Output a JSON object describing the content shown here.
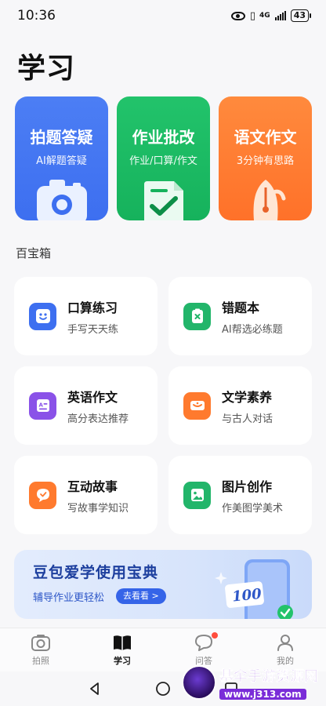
{
  "status": {
    "time": "10:36",
    "network": "4G",
    "battery": "43"
  },
  "page_title": "学习",
  "feature_cards": [
    {
      "title": "拍题答疑",
      "subtitle": "AI解题答疑",
      "icon": "camera-icon",
      "color": "#4c7ef4"
    },
    {
      "title": "作业批改",
      "subtitle": "作业/口算/作文",
      "icon": "check-document-icon",
      "color": "#22c36b"
    },
    {
      "title": "语文作文",
      "subtitle": "3分钟有思路",
      "icon": "pen-nib-icon",
      "color": "#ff8a3d"
    }
  ],
  "section_label": "百宝箱",
  "tools": [
    {
      "title": "口算练习",
      "subtitle": "手写天天练",
      "icon": "smile-face-icon",
      "color": "#3d6ff0"
    },
    {
      "title": "错题本",
      "subtitle": "AI帮选必练题",
      "icon": "wrong-clipboard-icon",
      "color": "#22b56a"
    },
    {
      "title": "英语作文",
      "subtitle": "高分表达推荐",
      "icon": "english-doc-icon",
      "color": "#8a52e8"
    },
    {
      "title": "文学素养",
      "subtitle": "与古人对话",
      "icon": "scroll-icon",
      "color": "#ff7a2e"
    },
    {
      "title": "互动故事",
      "subtitle": "写故事学知识",
      "icon": "chat-bubbles-icon",
      "color": "#ff7a2e"
    },
    {
      "title": "图片创作",
      "subtitle": "作美图学美术",
      "icon": "image-icon",
      "color": "#22b56a"
    }
  ],
  "banner": {
    "title": "豆包爱学使用宝典",
    "subtitle": "辅导作业更轻松",
    "button": "去看看 >",
    "art_text": "100"
  },
  "tabs": [
    {
      "label": "拍照",
      "icon": "camera-outline-icon",
      "active": false
    },
    {
      "label": "学习",
      "icon": "book-icon",
      "active": true
    },
    {
      "label": "问答",
      "icon": "chat-icon",
      "active": false
    },
    {
      "label": "我的",
      "icon": "person-icon",
      "active": false
    }
  ],
  "watermark": {
    "title": "基伞手游资源网",
    "url": "www.j313.com"
  }
}
